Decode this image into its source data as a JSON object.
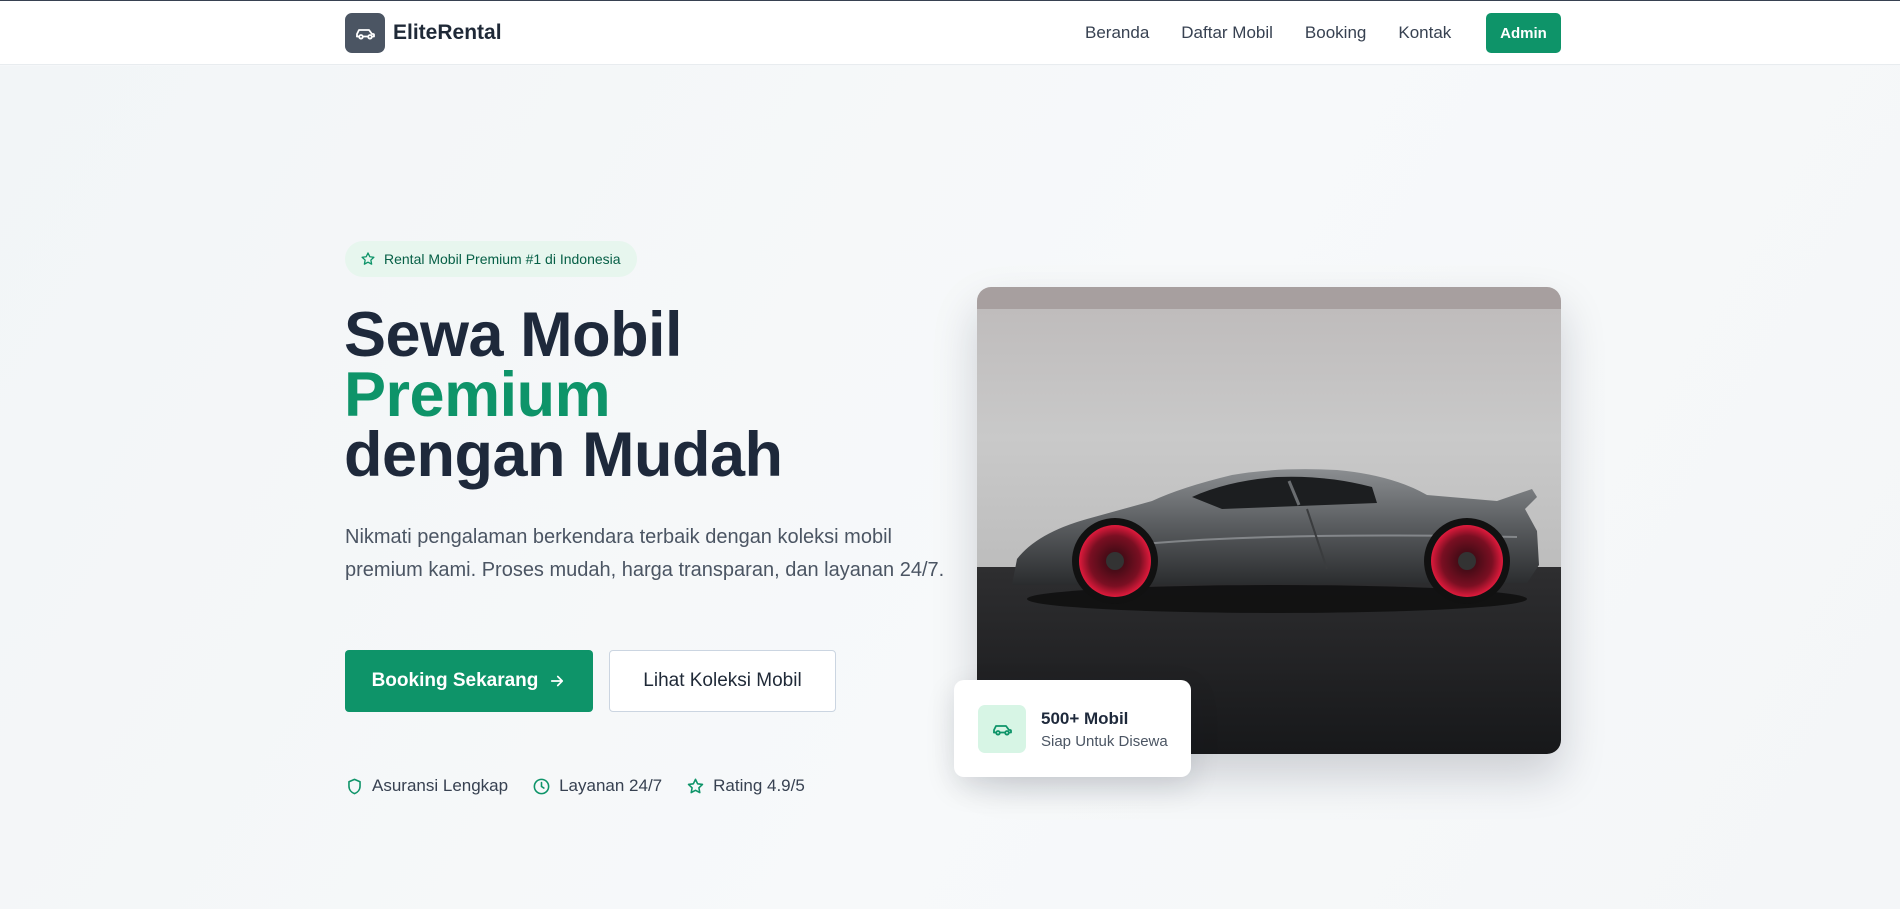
{
  "brand": {
    "name": "EliteRental",
    "logo_icon": "car-icon"
  },
  "nav": {
    "links": [
      "Beranda",
      "Daftar Mobil",
      "Booking",
      "Kontak"
    ],
    "admin_label": "Admin"
  },
  "hero": {
    "badge": "Rental Mobil Premium #1 di Indonesia",
    "title_line1": "Sewa Mobil",
    "title_accent": "Premium",
    "title_line3": "dengan Mudah",
    "description": "Nikmati pengalaman berkendara terbaik dengan koleksi mobil premium kami. Proses mudah, harga transparan, dan layanan 24/7.",
    "primary_button": "Booking Sekarang",
    "secondary_button": "Lihat Koleksi Mobil",
    "features": [
      {
        "icon": "shield-icon",
        "label": "Asuransi Lengkap"
      },
      {
        "icon": "clock-icon",
        "label": "Layanan 24/7"
      },
      {
        "icon": "star-icon",
        "label": "Rating 4.9/5"
      }
    ]
  },
  "stat_card": {
    "title": "500+ Mobil",
    "subtitle": "Siap Untuk Disewa",
    "icon": "car-icon"
  },
  "colors": {
    "accent": "#0e9469",
    "dark": "#1e293b",
    "badge_bg": "#e7f6ee",
    "logo_bg": "#4b5563"
  }
}
